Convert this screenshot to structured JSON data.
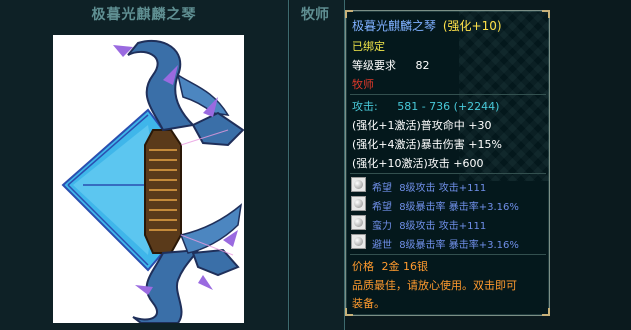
{
  "left_panel": {
    "title": "极暮光麒麟之琴"
  },
  "mid_panel": {
    "title": "牧师"
  },
  "tooltip": {
    "name": "极暮光麒麟之琴",
    "enhance": "(强化+10)",
    "bound": "已绑定",
    "level_label": "等级要求",
    "level_value": "82",
    "class": "牧师",
    "attack_label": "攻击:",
    "attack_value": "581 - 736 (+2244)",
    "bonuses": [
      "(强化+1激活)普攻命中 +30",
      "(强化+4激活)暴击伤害 +15%",
      "(强化+10激活)攻击 +600"
    ],
    "sockets": [
      {
        "name": "希望",
        "desc": "8级攻击 攻击+111"
      },
      {
        "name": "希望",
        "desc": "8级暴击率 暴击率+3.16%"
      },
      {
        "name": "蛮力",
        "desc": "8级攻击 攻击+111"
      },
      {
        "name": "避世",
        "desc": "8级暴击率 暴击率+3.16%"
      }
    ],
    "price_label": "价格",
    "price_value": "2金 16银",
    "note_line1": "品质最佳，请放心使用。双击即可",
    "note_line2": "装备。"
  },
  "colors": {
    "title_blue": "#7fb0ff",
    "enhance_yellow": "#ffe24a",
    "bound_yellow": "#f0e64a",
    "class_red": "#e0382a",
    "attack_cyan": "#48c8d8",
    "socket_blue": "#6f8fe8",
    "note_orange": "#ff9a2e"
  }
}
